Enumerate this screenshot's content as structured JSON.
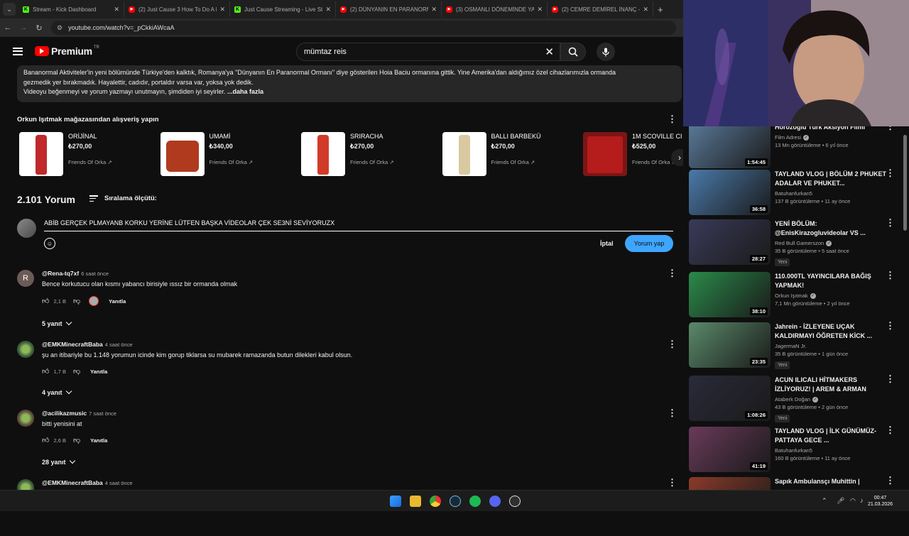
{
  "browser": {
    "tabs": [
      {
        "title": "Stream - Kick Dashboard",
        "type": "kick"
      },
      {
        "title": "(2) Just Cause 3 How To Do A F",
        "type": "yt"
      },
      {
        "title": "Just Cause Streaming - Live Stre",
        "type": "kick"
      },
      {
        "title": "(2) DÜNYANIN EN PARANORMA",
        "type": "yt"
      },
      {
        "title": "(3) OSMANLI DÖNEMİNDE YAŞ",
        "type": "yt"
      },
      {
        "title": "(2) CEMRE DEMİREL İNANÇ - Y",
        "type": "yt"
      }
    ],
    "url": "youtube.com/watch?v=_pCkkiAWcaA"
  },
  "header": {
    "logo_text": "Premium",
    "logo_badge": "TR",
    "search_value": "mümtaz reis",
    "search_clear": "✕"
  },
  "description": {
    "line1": "Bananormal Aktiviteler'in yeni bölümünde Türkiye'den kalktık, Romanya'ya \"Dünyanın En Paranormal Ormanı\" diye gösterilen Hoia Baciu ormanına gittik. Yine Amerika'dan aldığımız özel cihazlarımızla ormanda",
    "line2": "gezmedik yer bırakmadık. Hayalettir, cadıdır, portaldır varsa var, yoksa yok dedik.",
    "line3": "Videoyu beğenmeyi ve yorum yazmayı unutmayın, şimdiden iyi seyirler.",
    "more": "...daha fazla"
  },
  "shop": {
    "title": "Orkun Işıtmak mağazasından alışveriş yapın",
    "products": [
      {
        "name": "ORİJİNAL",
        "price": "₺270,00",
        "store": "Friends Of Orka ↗",
        "color": "#c0282c"
      },
      {
        "name": "UMAMİ",
        "price": "₺340,00",
        "store": "Friends Of Orka ↗",
        "color": "#b03a1e"
      },
      {
        "name": "SRIRACHA",
        "price": "₺270,00",
        "store": "Friends Of Orka ↗",
        "color": "#d23a2a"
      },
      {
        "name": "BALLI BARBEKÜ",
        "price": "₺270,00",
        "store": "Friends Of Orka ↗",
        "color": "#d8c9a0"
      },
      {
        "name": "1M SCOVILLE CI",
        "price": "₺525,00",
        "store": "Friends Of Orka ↗",
        "color": "#b51c1c"
      }
    ]
  },
  "comments_section": {
    "count": "2.101 Yorum",
    "sort_label": "Sıralama ölçütü:",
    "draft": "ABİB GERÇEK PLMAYANB KORKU YERİNE LÜTFEN BAŞKA VİDEOLAR ÇEK SE3Nİ SEVİYORUZX",
    "cancel_label": "İptal",
    "submit_label": "Yorum yap",
    "reply_label": "Yanıtla",
    "comments": [
      {
        "author": "@Rena-tq7xf",
        "time": "6 saat önce",
        "text": "Bence korkutucu olan kısmı yabancı birisiyle ıssız bir ormanda olmak",
        "likes": "2,1 B",
        "replies": "5 yanıt",
        "avatar_letter": "R",
        "avatar_color": "#6b5b56"
      },
      {
        "author": "@EMKMinecraftBaba",
        "time": "4 saat önce",
        "text": "şu an itibariyle bu 1.148 yorumun icinde kim gorup tiklarsa su mubarek ramazanda butun dilekleri kabul olsun.",
        "likes": "1,7 B",
        "replies": "4 yanıt",
        "avatar_letter": "",
        "avatar_color": "#3a5a3a"
      },
      {
        "author": "@acilikazmusic",
        "time": "7 saat önce",
        "text": "bitti yenisini at",
        "likes": "2,6 B",
        "replies": "28 yanıt",
        "avatar_letter": "",
        "avatar_color": "#5a4a3a"
      },
      {
        "author": "@EMKMinecraftBaba",
        "time": "4 saat önce",
        "text": "",
        "likes": "",
        "replies": "",
        "avatar_letter": "",
        "avatar_color": "#3a5a3a"
      }
    ]
  },
  "sidebar": {
    "videos": [
      {
        "title": "Horozoğlu Türk Aksiyon Filmi",
        "channel": "Film Adresi",
        "verified": true,
        "meta": "13 Mn görüntüleme • 6 yıl önce",
        "duration": "1:54:45",
        "badge": "",
        "color": "#5a7a9a"
      },
      {
        "title": "TAYLAND VLOG | BÖLÜM 2 PHUKET ADALAR VE PHUKET...",
        "channel": "Batuhanfurkan5",
        "verified": false,
        "meta": "137 B görüntüleme • 11 ay önce",
        "duration": "36:58",
        "badge": "",
        "color": "#4a7aaa"
      },
      {
        "title": "YENİ BÖLÜM: @EnisKirazogluvideolar VS ...",
        "channel": "Red Bull Gamerszon",
        "verified": true,
        "meta": "35 B görüntüleme • 5 saat önce",
        "duration": "28:27",
        "badge": "Yeni",
        "color": "#3a3a5a"
      },
      {
        "title": "110.000TL YAYINCILARA BAĞIŞ YAPMAK!",
        "channel": "Orkun Işıtmak",
        "verified": true,
        "meta": "7,1 Mn görüntüleme • 2 yıl önce",
        "duration": "38:10",
        "badge": "",
        "color": "#2a8a4a"
      },
      {
        "title": "Jahrein - İZLEYENE UÇAK KALDIRMAYI ÖĞRETEN KİCK ...",
        "channel": "JagermaN Jr.",
        "verified": false,
        "meta": "35 B görüntüleme • 1 gün önce",
        "duration": "23:35",
        "badge": "Yeni",
        "color": "#5a8a6a"
      },
      {
        "title": "ACUN ILICALI HİTMAKERS İZLİYORUZ! | AREM & ARMAN",
        "channel": "Ataberk Doğan",
        "verified": true,
        "meta": "43 B görüntüleme • 2 gün önce",
        "duration": "1:08:26",
        "badge": "Yeni",
        "color": "#2a2a3a"
      },
      {
        "title": "TAYLAND VLOG | İLK GÜNÜMÜZ- PATTAYA GECE ...",
        "channel": "Batuhanfurkan5",
        "verified": false,
        "meta": "160 B görüntüleme • 11 ay önce",
        "duration": "41:19",
        "badge": "",
        "color": "#6a3a5a"
      },
      {
        "title": "Sapık Ambulansçı Muhittin |",
        "channel": "",
        "verified": false,
        "meta": "",
        "duration": "",
        "badge": "",
        "color": "#8a3a2a"
      }
    ]
  },
  "taskbar": {
    "time": "00:47",
    "date": "21.03.2026"
  }
}
